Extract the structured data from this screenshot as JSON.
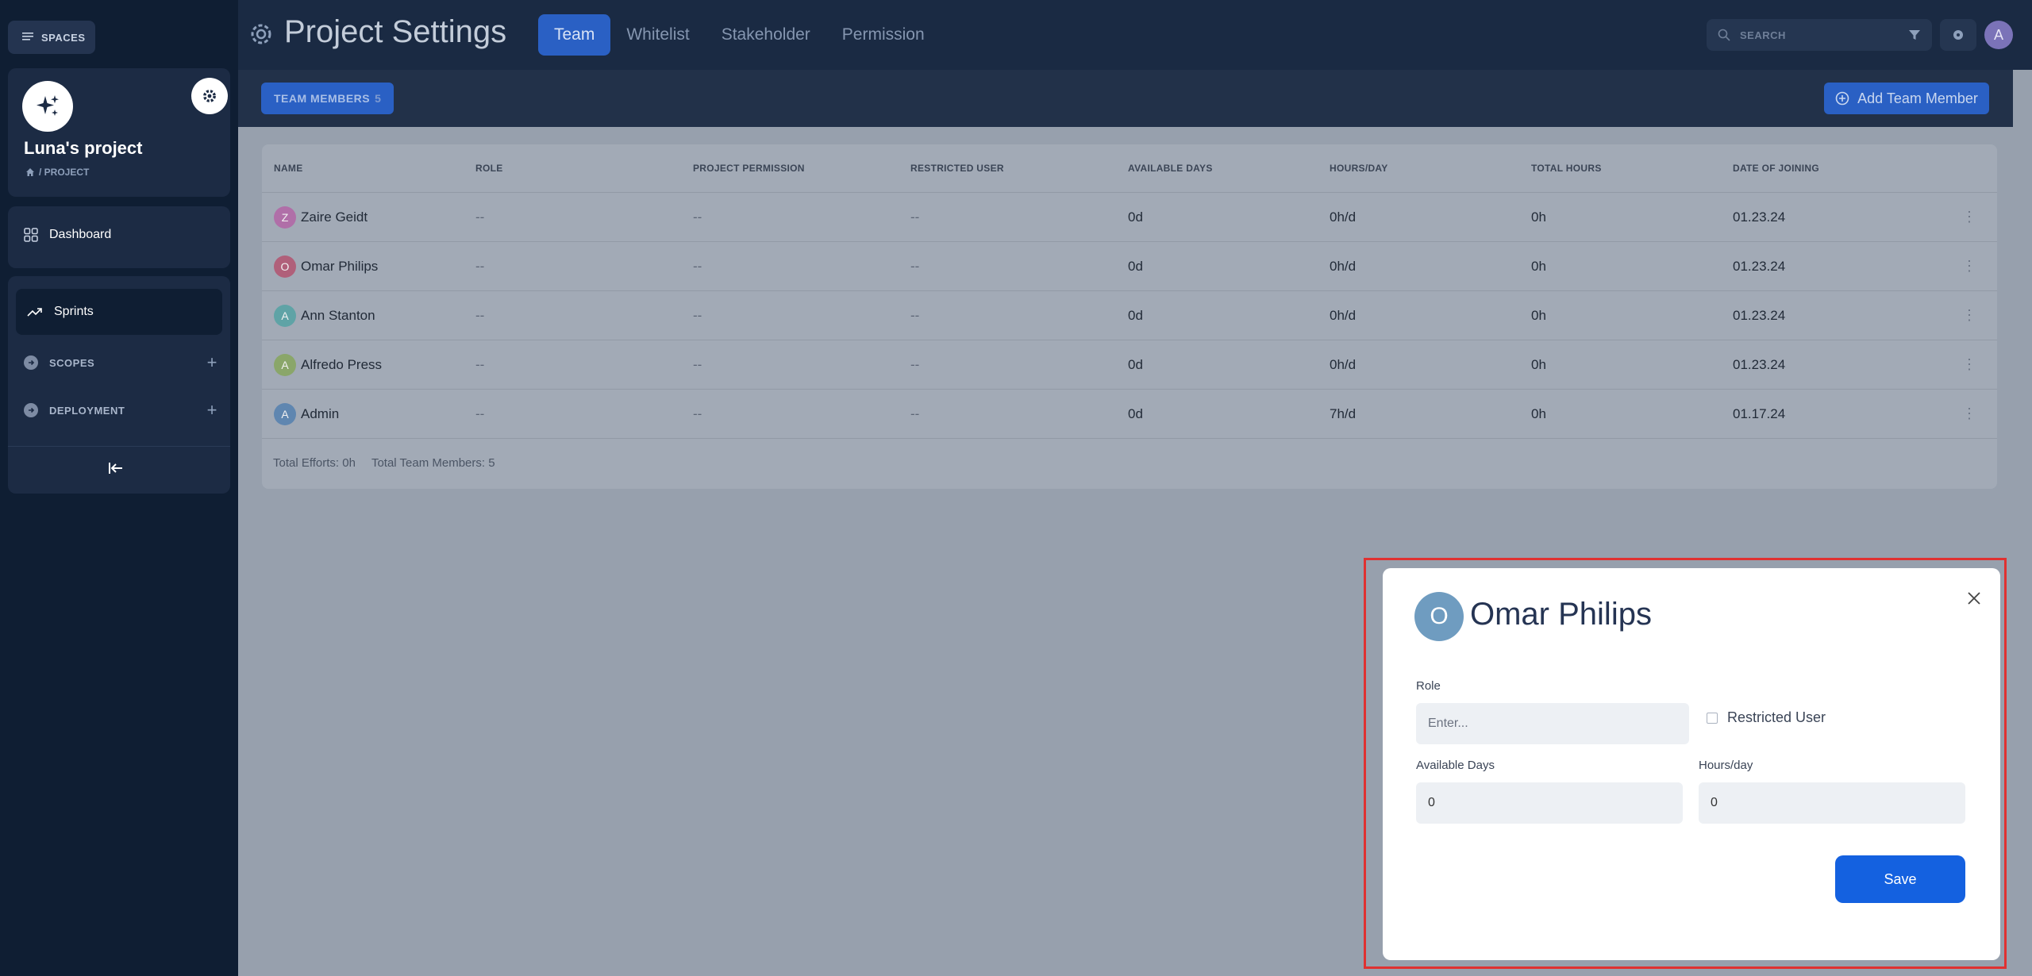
{
  "sidebar": {
    "spaces_label": "SPACES",
    "project_name": "Luna's project",
    "breadcrumb": "/ PROJECT",
    "dashboard_label": "Dashboard",
    "sprints_label": "Sprints",
    "scopes_label": "SCOPES",
    "deployment_label": "DEPLOYMENT"
  },
  "header": {
    "title": "Project Settings",
    "tabs": [
      {
        "label": "Team",
        "active": true
      },
      {
        "label": "Whitelist",
        "active": false
      },
      {
        "label": "Stakeholder",
        "active": false
      },
      {
        "label": "Permission",
        "active": false
      }
    ],
    "search_placeholder": "SEARCH",
    "user_initial": "A"
  },
  "team": {
    "badge_label": "TEAM MEMBERS",
    "badge_count": "5",
    "add_button": "Add Team Member",
    "columns": [
      "NAME",
      "ROLE",
      "PROJECT PERMISSION",
      "RESTRICTED USER",
      "AVAILABLE DAYS",
      "HOURS/DAY",
      "TOTAL HOURS",
      "DATE OF JOINING"
    ],
    "rows": [
      {
        "initial": "Z",
        "name": "Zaire Geidt",
        "role": "--",
        "permission": "--",
        "restricted": "--",
        "days": "0d",
        "hours_day": "0h/d",
        "total": "0h",
        "joined": "01.23.24",
        "color": "#b06fa8"
      },
      {
        "initial": "O",
        "name": "Omar Philips",
        "role": "--",
        "permission": "--",
        "restricted": "--",
        "days": "0d",
        "hours_day": "0h/d",
        "total": "0h",
        "joined": "01.23.24",
        "color": "#b0607a"
      },
      {
        "initial": "A",
        "name": "Ann Stanton",
        "role": "--",
        "permission": "--",
        "restricted": "--",
        "days": "0d",
        "hours_day": "0h/d",
        "total": "0h",
        "joined": "01.23.24",
        "color": "#5fa3a6"
      },
      {
        "initial": "A",
        "name": "Alfredo Press",
        "role": "--",
        "permission": "--",
        "restricted": "--",
        "days": "0d",
        "hours_day": "0h/d",
        "total": "0h",
        "joined": "01.23.24",
        "color": "#8aa66a"
      },
      {
        "initial": "A",
        "name": "Admin",
        "role": "--",
        "permission": "--",
        "restricted": "--",
        "days": "0d",
        "hours_day": "7h/d",
        "total": "0h",
        "joined": "01.17.24",
        "color": "#5f86b0"
      }
    ],
    "total_efforts_label": "Total Efforts:",
    "total_efforts_value": "0h",
    "total_members_label": "Total Team Members:",
    "total_members_value": "5"
  },
  "modal": {
    "initial": "O",
    "name": "Omar Philips",
    "role_label": "Role",
    "role_placeholder": "Enter...",
    "restricted_label": "Restricted User",
    "days_label": "Available Days",
    "days_value": "0",
    "hours_label": "Hours/day",
    "hours_value": "0",
    "save_label": "Save"
  }
}
